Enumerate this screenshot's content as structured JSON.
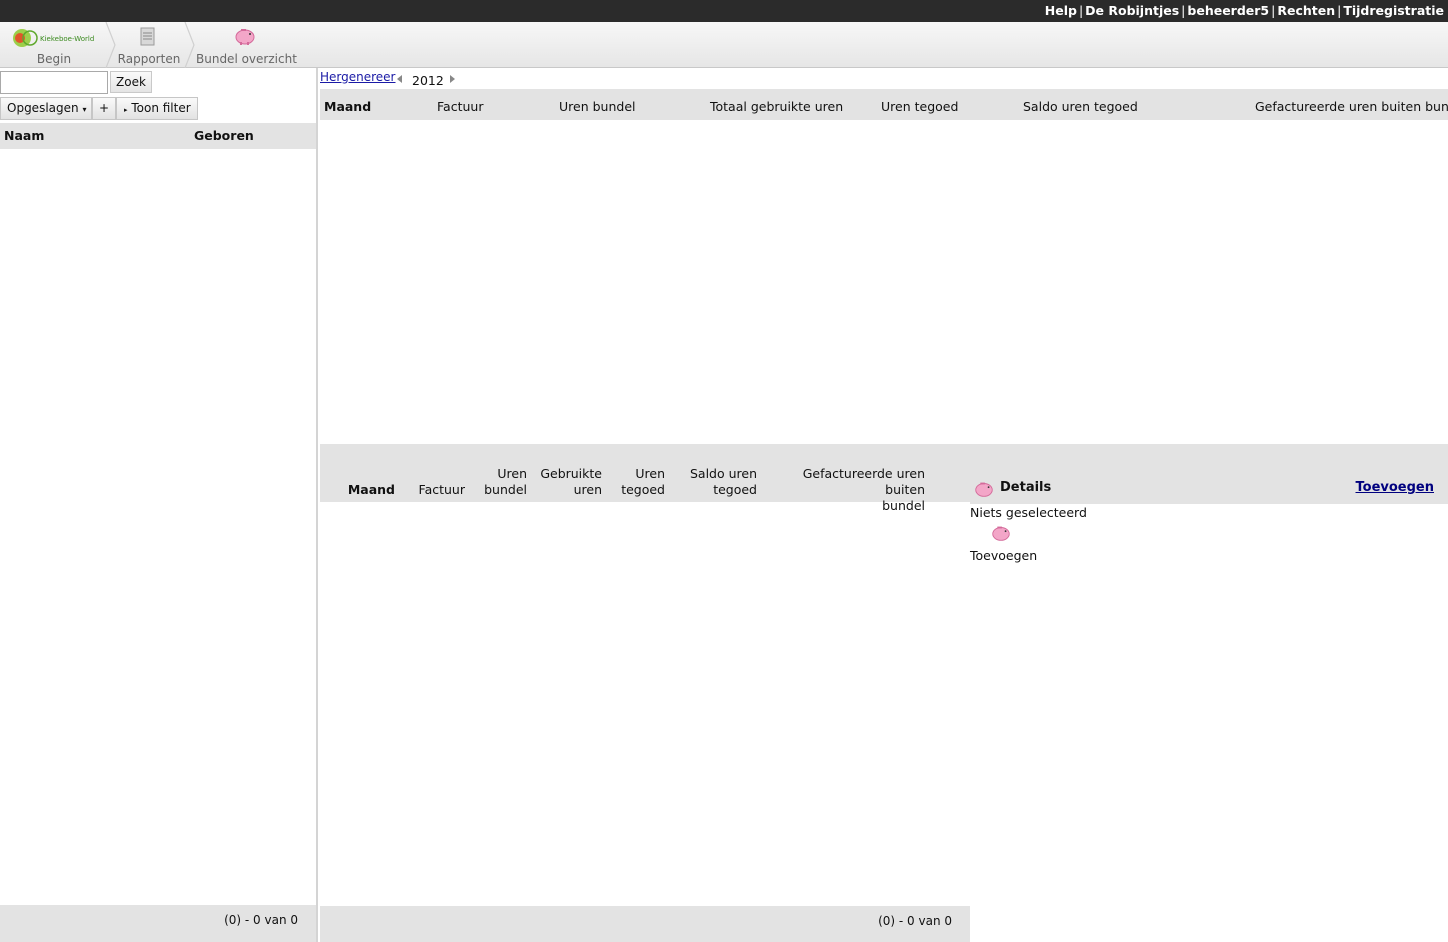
{
  "topbar": {
    "links": [
      "Help",
      "De Robijntjes",
      "beheerder5",
      "Rechten",
      "Tijdregistratie"
    ],
    "separator": "|"
  },
  "nav": {
    "logo_text": "Kiekeboe-World",
    "crumbs": [
      {
        "label": "Begin",
        "icon": "logo-icon"
      },
      {
        "label": "Rapporten",
        "icon": "report-icon"
      },
      {
        "label": "Bundel overzicht",
        "icon": "piggy-bank-icon"
      }
    ]
  },
  "left": {
    "search_value": "",
    "search_button": "Zoek",
    "saved_button": "Opgeslagen",
    "add_button": "+",
    "filter_button": "Toon filter",
    "columns": [
      "Naam",
      "Geboren"
    ],
    "pager": "(0) - 0 van 0"
  },
  "top": {
    "regenerate": "Hergenereer",
    "year": "2012",
    "columns": [
      "Maand",
      "Factuur",
      "Uren bundel",
      "Totaal gebruikte uren",
      "Uren tegoed",
      "Saldo uren tegoed",
      "Gefactureerde uren buiten bundel"
    ]
  },
  "bottom": {
    "columns": [
      {
        "line1": "",
        "line2": "Maand"
      },
      {
        "line1": "",
        "line2": "Factuur"
      },
      {
        "line1": "Uren",
        "line2": "bundel"
      },
      {
        "line1": "Gebruikte",
        "line2": "uren"
      },
      {
        "line1": "Uren",
        "line2": "tegoed"
      },
      {
        "line1": "Saldo uren",
        "line2": "tegoed"
      },
      {
        "line1": "Gefactureerde uren buiten",
        "line2": "bundel"
      }
    ],
    "pager": "(0) - 0 van 0"
  },
  "details": {
    "title": "Details",
    "add_link": "Toevoegen",
    "empty_text": "Niets geselecteerd",
    "add_label": "Toevoegen"
  },
  "colors": {
    "topbar": "#2b2b2b",
    "header_gray": "#e3e3e3",
    "link_blue": "#1a1aa6",
    "piggy_pink": "#f3a6c8"
  }
}
